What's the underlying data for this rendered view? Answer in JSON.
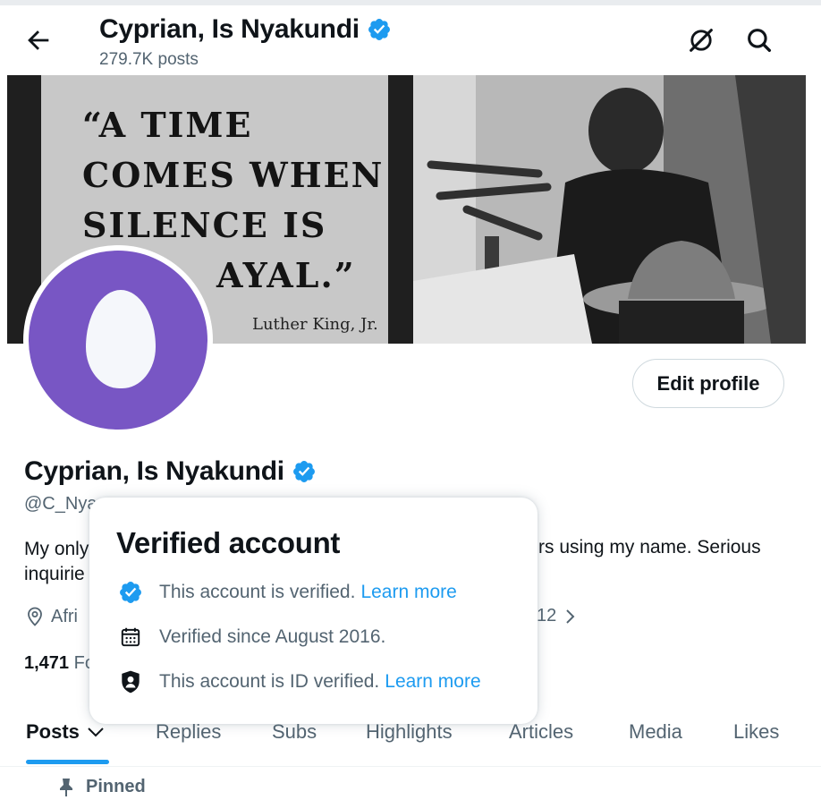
{
  "header": {
    "name": "Cyprian, Is Nyakundi",
    "posts_count": "279.7K posts"
  },
  "banner": {
    "quote": "“A TIME COMES WHEN SILENCE IS AYAL.”",
    "quote_lines": [
      "“A TIME",
      "COMES WHEN",
      "SILENCE IS",
      "AYAL.”"
    ],
    "attribution": "Luther King, Jr."
  },
  "profile": {
    "edit_label": "Edit profile",
    "name": "Cyprian, Is Nyakundi",
    "handle": "@C_Nya",
    "bio_left_1": "My only",
    "bio_left_2": "inquirie",
    "bio_right": "rs using my name. Serious",
    "location_frag": "Afri",
    "joined_frag": "12",
    "following_count": "1,471",
    "following_frag": "Fo"
  },
  "popover": {
    "title": "Verified account",
    "rows": [
      {
        "text": "This account is verified.",
        "link": "Learn more",
        "icon": "verified-badge-icon"
      },
      {
        "text": "Verified since August 2016.",
        "link": "",
        "icon": "calendar-icon"
      },
      {
        "text": "This account is ID verified.",
        "link": "Learn more",
        "icon": "id-shield-icon"
      }
    ]
  },
  "tabs": [
    {
      "label": "Posts",
      "active": true
    },
    {
      "label": "Replies"
    },
    {
      "label": "Subs"
    },
    {
      "label": "Highlights"
    },
    {
      "label": "Articles"
    },
    {
      "label": "Media"
    },
    {
      "label": "Likes"
    }
  ],
  "pinned_label": "Pinned",
  "colors": {
    "accent": "#1d9bf0",
    "avatar_bg": "#7856c4",
    "secondary_text": "#536471"
  }
}
